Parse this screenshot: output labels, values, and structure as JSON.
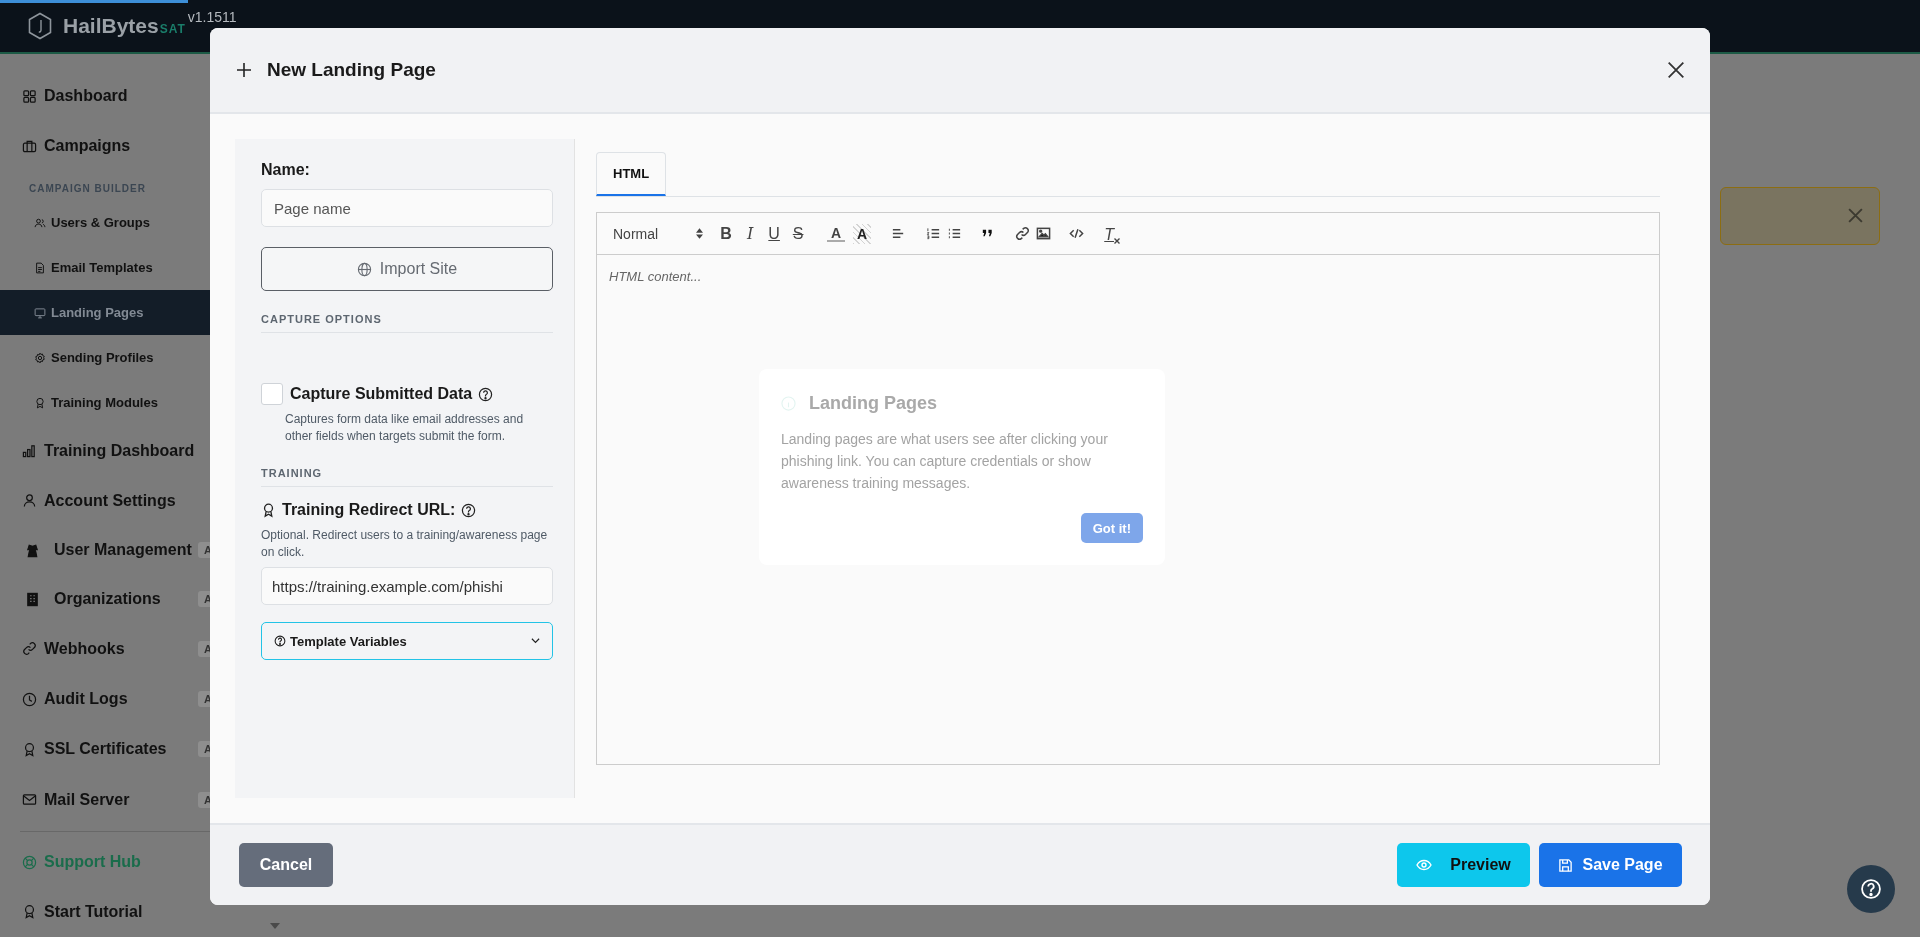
{
  "app": {
    "brand": "HailBytes",
    "edition": "SAT",
    "version": "v1.1511"
  },
  "sidebar": {
    "items": [
      {
        "kind": "main",
        "label": "Dashboard",
        "selected": false
      },
      {
        "kind": "main",
        "label": "Campaigns",
        "selected": false
      },
      {
        "kind": "heading",
        "label": "CAMPAIGN BUILDER"
      },
      {
        "kind": "sub",
        "label": "Users & Groups",
        "selected": false
      },
      {
        "kind": "sub",
        "label": "Email Templates",
        "selected": false
      },
      {
        "kind": "sub",
        "label": "Landing Pages",
        "selected": true
      },
      {
        "kind": "sub",
        "label": "Sending Profiles",
        "selected": false
      },
      {
        "kind": "sub",
        "label": "Training Modules",
        "selected": false
      },
      {
        "kind": "main",
        "label": "Training Dashboard",
        "selected": false
      },
      {
        "kind": "main",
        "label": "Account Settings",
        "selected": false
      },
      {
        "kind": "wide",
        "label": "User Management",
        "selected": false,
        "badge": "A"
      },
      {
        "kind": "wide",
        "label": "Organizations",
        "selected": false,
        "badge": "A"
      },
      {
        "kind": "main",
        "label": "Webhooks",
        "selected": false,
        "badge": "A"
      },
      {
        "kind": "main",
        "label": "Audit Logs",
        "selected": false,
        "badge": "A"
      },
      {
        "kind": "main",
        "label": "SSL Certificates",
        "selected": false,
        "badge": "A"
      },
      {
        "kind": "main",
        "label": "Mail Server",
        "selected": false,
        "badge": "A"
      }
    ],
    "footer_items": [
      {
        "kind": "accent",
        "label": "Support Hub",
        "selected": false
      },
      {
        "kind": "main",
        "label": "Start Tutorial",
        "selected": false
      }
    ]
  },
  "modal": {
    "title": "New Landing Page",
    "form": {
      "name": {
        "label": "Name:",
        "placeholder": "Page name"
      },
      "import_button": "Import Site",
      "capture_section": "CAPTURE OPTIONS",
      "capture": {
        "label": "Capture Submitted Data",
        "checked": false,
        "help": "Captures form data like email addresses and other fields when targets submit the form."
      },
      "training_section": "TRAINING",
      "redirect": {
        "label": "Training Redirect URL:",
        "help": "Optional. Redirect users to a training/awareness page on click.",
        "value": "https://training.example.com/phishi"
      },
      "template_variables": {
        "label": "Template Variables",
        "expanded": false
      }
    },
    "editor": {
      "tabs": [
        {
          "label": "HTML",
          "selected": true
        }
      ],
      "toolbar": [
        {
          "kind": "select",
          "label": "Normal"
        },
        {
          "kind": "bold",
          "label": "B"
        },
        {
          "kind": "italic",
          "label": "I"
        },
        {
          "kind": "underline",
          "label": "U"
        },
        {
          "kind": "strike",
          "label": "S"
        },
        {
          "kind": "color",
          "label": "A"
        },
        {
          "kind": "background",
          "label": "A"
        },
        {
          "kind": "align"
        },
        {
          "kind": "ordered"
        },
        {
          "kind": "bullet"
        },
        {
          "kind": "quote"
        },
        {
          "kind": "link"
        },
        {
          "kind": "image"
        },
        {
          "kind": "code"
        },
        {
          "kind": "clean",
          "label": "T"
        }
      ],
      "placeholder": "HTML content...",
      "tour": {
        "title": "Landing Pages",
        "text": "Landing pages are what users see after clicking your phishing link. You can capture credentials or show awareness training messages.",
        "button": "Got it!"
      }
    },
    "footer": {
      "cancel": "Cancel",
      "preview": "Preview",
      "save": "Save Page"
    }
  }
}
